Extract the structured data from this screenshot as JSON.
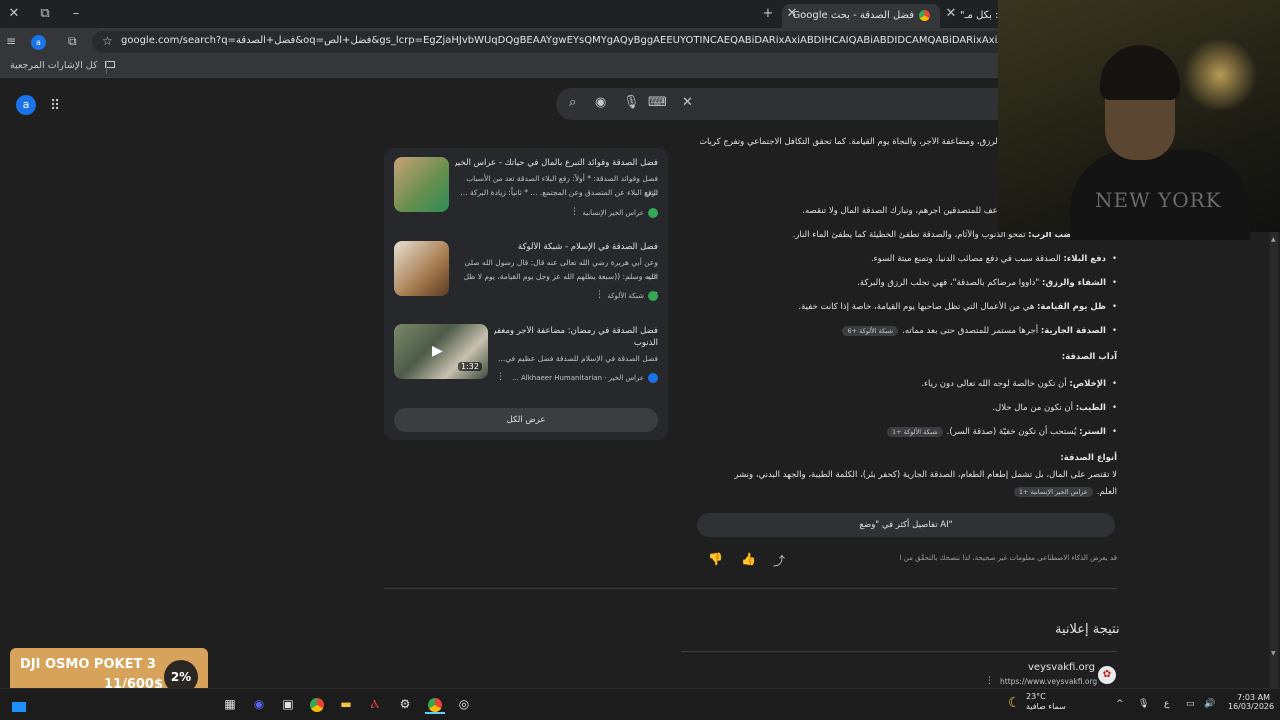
{
  "window": {
    "close": "✕",
    "restore": "⧉",
    "minimize": "–",
    "new_tab": "+",
    "tab_close": "✕",
    "tab_active_title": "فضل الصدقة - بحث Google",
    "tab_prev_title": "\"بكل مـ :oa"
  },
  "toolbar": {
    "url": "google.com/search?q=فضل+الصدقة&oq=فضل+الص&gs_lcrp=EgZjaHJvbWUqDQgBEAAYgwEYsQMYgAQyBggAEEUYOTINCAEQABiDARixAxiABDIHCAIQABiABDIDCAMQABiDARixAxiABBiKBTIHCAQQABiABDIHCAUQ",
    "profile_letter": "a",
    "bookmarks_label": "كل الإشارات المرجعية"
  },
  "search": {
    "avatar_letter": "a",
    "clear": "✕"
  },
  "left_cards": [
    {
      "title": "فضل الصدقة وفوائد التبرع بالمال في حياتك - عراس الخير",
      "snippet1": "فضل وفوائد الصدقة: * أولاً: رفع البلاء الصدقة تعد من الأسباب التي",
      "snippet2": "ترفع البلاء عن المتصدق وعن المجتمع. ... * ثانياً: زيادة البركة ...",
      "source": "عراس الخير الإنسانية"
    },
    {
      "title": "فضل الصدقة في الإسلام - شبكة الألوكة",
      "snippet1": "وعن أبي هريرة رضي الله تعالى عنه قال: قال رسول الله صلى الله",
      "snippet2": "عليه وسلم: ((سبعة يظلهم الله عز وجل يوم القيامة، يوم لا ظل ...",
      "source": "شبكة الألوكة"
    },
    {
      "title": "فضل الصدقة في رمضان: مضاعفة الأجر ومغفرة",
      "title2": "الذنوب",
      "snippet1": "فضل الصدقة في الإسلام للصدقة فضل عظيم في...",
      "source": "عراس الخير · Alkhaeer Humanitarian ...",
      "duration": "1:32"
    }
  ],
  "view_all": "عرض الكل",
  "answer": {
    "top1": "الرزق، ومضاعفة الأجر، والنجاة يوم القيامة. كما تحقق التكافل الاجتماعي وتفرج كربات",
    "top2": "اعف للمتصدقين أجرهم، وتبارك الصدقة المال ولا تنقصه.",
    "b1_bold": "تطفئ غضب الرب:",
    "b1": " تمحو الذنوب والآثام، والصدقة تطفئ الخطيئة كما يطفئ الماء النار.",
    "b2_bold": "دفع البلاء:",
    "b2": " الصدقة سبب في دفع مصائب الدنيا، وتمنع ميتة السوء.",
    "b3_bold": "الشفاء والرزق:",
    "b3": " \"داووا مرضاكم بالصدقة\"، فهي تجلب الرزق والبركة.",
    "b4_bold": "ظل يوم القيامة:",
    "b4": " هي من الأعمال التي تظل صاحبها يوم القيامة، خاصة إذا كانت خفية.",
    "b5_bold": "الصدقة الجارية:",
    "b5": " أجرها مستمر للمتصدق حتى بعد مماته.",
    "b5_chip": "شبكة الألوكة +6",
    "adab_heading": "آداب الصدقة:",
    "c1_bold": "الإخلاص:",
    "c1": " أن تكون خالصة لوجه الله تعالى دون رياء.",
    "c2_bold": "الطيب:",
    "c2": " أن تكون من مال حلال.",
    "c3_bold": "الستر:",
    "c3": " يُستحب أن تكون خفيّة (صدقة السر).",
    "c3_chip": "شبكة الألوكة +1",
    "types_heading": "أنواع الصدقة:",
    "types1": "لا تقتصر على المال، بل تشمل إطعام الطعام، الصدقة الجارية (كحفر بئر)، الكلمة الطيبة، والجهد البدني، ونشر",
    "types2": "العلم.",
    "types_chip": "عراس الخير الإنسانية +1"
  },
  "more_ai": "تفاصيل أكثر في \"وضع AI\"",
  "disclaimer": "قد يعرض الذكاء الاصطناعي معلومات غير صحيحة، لذا ننصحك بالتحقّق من الردود.",
  "ad": {
    "heading": "نتيجة إعلانية",
    "name": "veysvakfi.org",
    "url": "https://www.veysvakfi.org"
  },
  "webcam": {
    "shirt_text": "NEW YORK"
  },
  "promo": {
    "title": "DJI OSMO POKET 3",
    "progress": "11/600$",
    "percent": "2%"
  },
  "taskbar": {
    "weather_temp": "23°C",
    "weather_desc": "سماء صافية",
    "time": "7:03 AM",
    "date": "16/03/2026",
    "lang": "ع"
  }
}
